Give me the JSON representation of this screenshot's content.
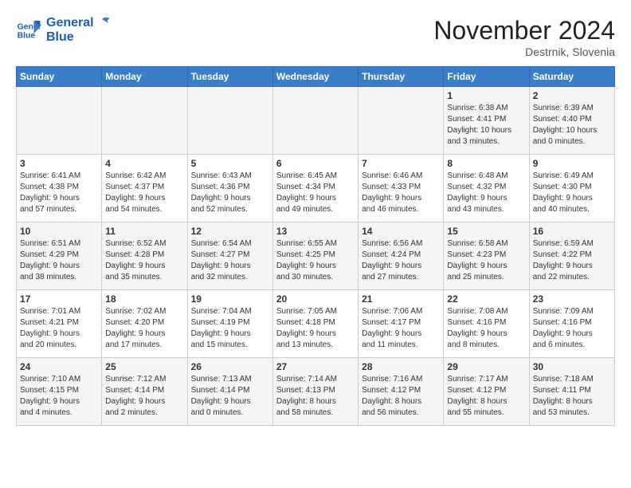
{
  "header": {
    "logo_line1": "General",
    "logo_line2": "Blue",
    "month_title": "November 2024",
    "location": "Destrnik, Slovenia"
  },
  "weekdays": [
    "Sunday",
    "Monday",
    "Tuesday",
    "Wednesday",
    "Thursday",
    "Friday",
    "Saturday"
  ],
  "weeks": [
    [
      {
        "day": "",
        "info": ""
      },
      {
        "day": "",
        "info": ""
      },
      {
        "day": "",
        "info": ""
      },
      {
        "day": "",
        "info": ""
      },
      {
        "day": "",
        "info": ""
      },
      {
        "day": "1",
        "info": "Sunrise: 6:38 AM\nSunset: 4:41 PM\nDaylight: 10 hours\nand 3 minutes."
      },
      {
        "day": "2",
        "info": "Sunrise: 6:39 AM\nSunset: 4:40 PM\nDaylight: 10 hours\nand 0 minutes."
      }
    ],
    [
      {
        "day": "3",
        "info": "Sunrise: 6:41 AM\nSunset: 4:38 PM\nDaylight: 9 hours\nand 57 minutes."
      },
      {
        "day": "4",
        "info": "Sunrise: 6:42 AM\nSunset: 4:37 PM\nDaylight: 9 hours\nand 54 minutes."
      },
      {
        "day": "5",
        "info": "Sunrise: 6:43 AM\nSunset: 4:36 PM\nDaylight: 9 hours\nand 52 minutes."
      },
      {
        "day": "6",
        "info": "Sunrise: 6:45 AM\nSunset: 4:34 PM\nDaylight: 9 hours\nand 49 minutes."
      },
      {
        "day": "7",
        "info": "Sunrise: 6:46 AM\nSunset: 4:33 PM\nDaylight: 9 hours\nand 46 minutes."
      },
      {
        "day": "8",
        "info": "Sunrise: 6:48 AM\nSunset: 4:32 PM\nDaylight: 9 hours\nand 43 minutes."
      },
      {
        "day": "9",
        "info": "Sunrise: 6:49 AM\nSunset: 4:30 PM\nDaylight: 9 hours\nand 40 minutes."
      }
    ],
    [
      {
        "day": "10",
        "info": "Sunrise: 6:51 AM\nSunset: 4:29 PM\nDaylight: 9 hours\nand 38 minutes."
      },
      {
        "day": "11",
        "info": "Sunrise: 6:52 AM\nSunset: 4:28 PM\nDaylight: 9 hours\nand 35 minutes."
      },
      {
        "day": "12",
        "info": "Sunrise: 6:54 AM\nSunset: 4:27 PM\nDaylight: 9 hours\nand 32 minutes."
      },
      {
        "day": "13",
        "info": "Sunrise: 6:55 AM\nSunset: 4:25 PM\nDaylight: 9 hours\nand 30 minutes."
      },
      {
        "day": "14",
        "info": "Sunrise: 6:56 AM\nSunset: 4:24 PM\nDaylight: 9 hours\nand 27 minutes."
      },
      {
        "day": "15",
        "info": "Sunrise: 6:58 AM\nSunset: 4:23 PM\nDaylight: 9 hours\nand 25 minutes."
      },
      {
        "day": "16",
        "info": "Sunrise: 6:59 AM\nSunset: 4:22 PM\nDaylight: 9 hours\nand 22 minutes."
      }
    ],
    [
      {
        "day": "17",
        "info": "Sunrise: 7:01 AM\nSunset: 4:21 PM\nDaylight: 9 hours\nand 20 minutes."
      },
      {
        "day": "18",
        "info": "Sunrise: 7:02 AM\nSunset: 4:20 PM\nDaylight: 9 hours\nand 17 minutes."
      },
      {
        "day": "19",
        "info": "Sunrise: 7:04 AM\nSunset: 4:19 PM\nDaylight: 9 hours\nand 15 minutes."
      },
      {
        "day": "20",
        "info": "Sunrise: 7:05 AM\nSunset: 4:18 PM\nDaylight: 9 hours\nand 13 minutes."
      },
      {
        "day": "21",
        "info": "Sunrise: 7:06 AM\nSunset: 4:17 PM\nDaylight: 9 hours\nand 11 minutes."
      },
      {
        "day": "22",
        "info": "Sunrise: 7:08 AM\nSunset: 4:16 PM\nDaylight: 9 hours\nand 8 minutes."
      },
      {
        "day": "23",
        "info": "Sunrise: 7:09 AM\nSunset: 4:16 PM\nDaylight: 9 hours\nand 6 minutes."
      }
    ],
    [
      {
        "day": "24",
        "info": "Sunrise: 7:10 AM\nSunset: 4:15 PM\nDaylight: 9 hours\nand 4 minutes."
      },
      {
        "day": "25",
        "info": "Sunrise: 7:12 AM\nSunset: 4:14 PM\nDaylight: 9 hours\nand 2 minutes."
      },
      {
        "day": "26",
        "info": "Sunrise: 7:13 AM\nSunset: 4:14 PM\nDaylight: 9 hours\nand 0 minutes."
      },
      {
        "day": "27",
        "info": "Sunrise: 7:14 AM\nSunset: 4:13 PM\nDaylight: 8 hours\nand 58 minutes."
      },
      {
        "day": "28",
        "info": "Sunrise: 7:16 AM\nSunset: 4:12 PM\nDaylight: 8 hours\nand 56 minutes."
      },
      {
        "day": "29",
        "info": "Sunrise: 7:17 AM\nSunset: 4:12 PM\nDaylight: 8 hours\nand 55 minutes."
      },
      {
        "day": "30",
        "info": "Sunrise: 7:18 AM\nSunset: 4:11 PM\nDaylight: 8 hours\nand 53 minutes."
      }
    ]
  ]
}
